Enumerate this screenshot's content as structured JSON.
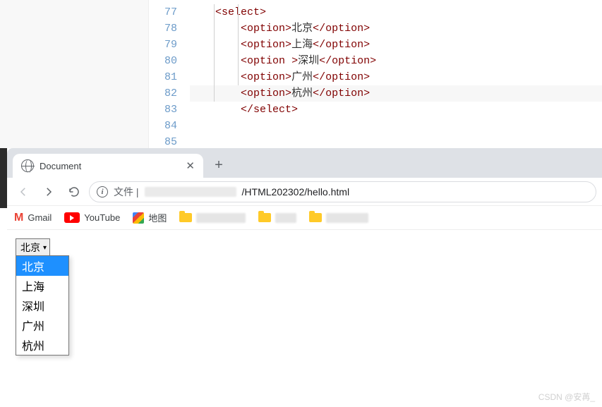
{
  "editor": {
    "line_numbers": [
      "77",
      "78",
      "79",
      "80",
      "81",
      "82",
      "83",
      "84",
      "85"
    ],
    "tags": {
      "select_open": "select",
      "select_close": "select",
      "option": "option"
    },
    "option_texts": [
      "北京",
      "上海",
      "深圳",
      "广州",
      "杭州"
    ]
  },
  "browser": {
    "tab": {
      "title": "Document"
    },
    "address": {
      "label": "文件",
      "path": "/HTML202302/hello.html"
    },
    "bookmarks": {
      "gmail": "Gmail",
      "youtube": "YouTube",
      "maps": "地图"
    },
    "select": {
      "selected": "北京",
      "options": [
        "北京",
        "上海",
        "深圳",
        "广州",
        "杭州"
      ]
    }
  },
  "watermark": "CSDN @安苒_"
}
